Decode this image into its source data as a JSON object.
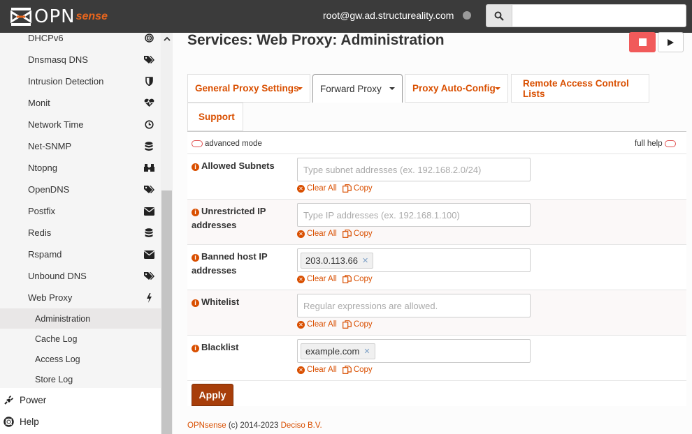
{
  "header": {
    "logo_main": "OPN",
    "logo_sense": "sense",
    "user": "root@gw.ad.structureality.com",
    "search_placeholder": ""
  },
  "sidebar": {
    "items": [
      {
        "label": "DHCPv6",
        "icon": "target-icon"
      },
      {
        "label": "Dnsmasq DNS",
        "icon": "tags-icon"
      },
      {
        "label": "Intrusion Detection",
        "icon": "shield-icon"
      },
      {
        "label": "Monit",
        "icon": "heartbeat-icon"
      },
      {
        "label": "Network Time",
        "icon": "clock-icon"
      },
      {
        "label": "Net-SNMP",
        "icon": "database-icon"
      },
      {
        "label": "Ntopng",
        "icon": "binoculars-icon"
      },
      {
        "label": "OpenDNS",
        "icon": "tags-icon"
      },
      {
        "label": "Postfix",
        "icon": "envelope-icon"
      },
      {
        "label": "Redis",
        "icon": "database-icon"
      },
      {
        "label": "Rspamd",
        "icon": "envelope-icon"
      },
      {
        "label": "Unbound DNS",
        "icon": "tags-icon"
      },
      {
        "label": "Web Proxy",
        "icon": "bolt-icon"
      }
    ],
    "subitems": [
      {
        "label": "Administration",
        "active": true
      },
      {
        "label": "Cache Log",
        "active": false
      },
      {
        "label": "Access Log",
        "active": false
      },
      {
        "label": "Store Log",
        "active": false
      }
    ],
    "bottom": [
      {
        "label": "Power",
        "icon": "plug-icon"
      },
      {
        "label": "Help",
        "icon": "lifering-icon"
      }
    ]
  },
  "main": {
    "title": "Services: Web Proxy: Administration",
    "tabs": [
      {
        "label": "General Proxy Settings",
        "dropdown": true,
        "active": false
      },
      {
        "label": "Forward Proxy",
        "dropdown": true,
        "active": true
      },
      {
        "label": "Proxy Auto-Config",
        "dropdown": true,
        "active": false
      },
      {
        "label": "Remote Access Control Lists",
        "dropdown": false,
        "active": false
      },
      {
        "label": "Support",
        "dropdown": false,
        "active": false
      }
    ],
    "advanced_mode": "advanced mode",
    "full_help": "full help",
    "fields": [
      {
        "label": "Allowed Subnets",
        "placeholder": "Type subnet addresses (ex. 192.168.2.0/24)",
        "chips": []
      },
      {
        "label": "Unrestricted IP addresses",
        "placeholder": "Type IP addresses (ex. 192.168.1.100)",
        "chips": []
      },
      {
        "label": "Banned host IP addresses",
        "placeholder": "",
        "chips": [
          "203.0.113.66"
        ]
      },
      {
        "label": "Whitelist",
        "placeholder": "Regular expressions are allowed.",
        "chips": []
      },
      {
        "label": "Blacklist",
        "placeholder": "",
        "chips": [
          "example.com"
        ]
      }
    ],
    "clear_all": "Clear All",
    "copy": "Copy",
    "apply": "Apply"
  },
  "footer": {
    "brand": "OPNsense",
    "copyright": "(c) 2014-2023",
    "company": "Deciso B.V."
  },
  "colors": {
    "accent": "#d94f00",
    "header_bg": "#3b3b3b",
    "stop": "#f15a5a",
    "apply": "#a73e0a"
  }
}
